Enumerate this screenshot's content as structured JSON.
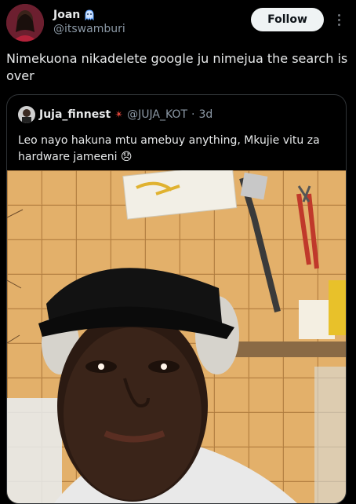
{
  "author": {
    "name": "Joan",
    "handle": "@itswamburi"
  },
  "follow_label": "Follow",
  "tweet_text": "Nimekuona nikadelete google ju nimejua the search is over",
  "quote": {
    "name": "Juja_finnest",
    "name_emoji": "✴",
    "handle": "@JUJA_KOT",
    "separator": "·",
    "time": "3d",
    "text": "Leo nayo hakuna mtu amebuy anything, Mkujie vitu za hardware jameeni 😞"
  },
  "colors": {
    "background": "#000000",
    "text": "#e7e9ea",
    "muted": "#8b98a5",
    "border": "#2f3336",
    "follow_bg": "#eff3f4",
    "follow_text": "#0f1419"
  },
  "icons": {
    "badge": "ghost-emoji-icon",
    "more": "more-vertical-icon",
    "quote_emoji": "red-starburst-icon"
  }
}
